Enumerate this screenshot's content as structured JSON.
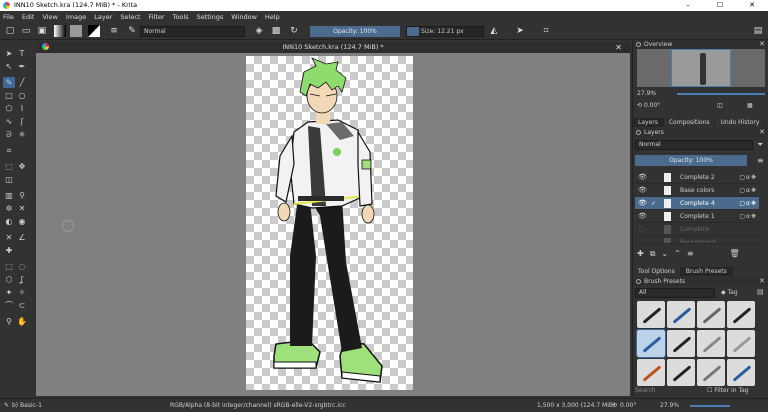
{
  "window": {
    "title": "INN10 Sketch.kra (124.7 MiB) * - Krita",
    "controls": [
      "–",
      "☐",
      "✕"
    ]
  },
  "menu": [
    "File",
    "Edit",
    "View",
    "Image",
    "Layer",
    "Select",
    "Filter",
    "Tools",
    "Settings",
    "Window",
    "Help"
  ],
  "toolbar": {
    "blend_mode": "Normal",
    "opacity": "Opacity: 100%",
    "size": "Size: 12.21 px"
  },
  "document": {
    "tab_title": "INN10 Sketch.kra (124.7 MiB) *",
    "close": "✕"
  },
  "overview": {
    "title": "Overview",
    "zoom": "27.9%",
    "rotation": "0.00°"
  },
  "dock_tabs": [
    "Layers",
    "Compositions",
    "Undo History"
  ],
  "layers": {
    "title": "Layers",
    "blend_mode": "Normal",
    "opacity": "Opacity: 100%",
    "items": [
      {
        "name": "Complete 2",
        "state": "normal"
      },
      {
        "name": "Base colors",
        "state": "normal"
      },
      {
        "name": "Complete 4",
        "state": "selected"
      },
      {
        "name": "Complete 1",
        "state": "normal"
      },
      {
        "name": "Complete",
        "state": "dim"
      },
      {
        "name": "Background",
        "state": "dim"
      }
    ]
  },
  "bottom_tabs": [
    "Tool Options",
    "Brush Presets"
  ],
  "brush_presets": {
    "title": "Brush Presets",
    "filter": "All",
    "tag_label": "Tag",
    "search_placeholder": "Search",
    "filter_in_tag": "Filter in Tag"
  },
  "status": {
    "brush": "b) Basic-1",
    "color_space": "RGB/Alpha (8-bit integer/channel)  sRGB-elle-V2-srgbtrc.icc",
    "dimensions": "1,500 x 3,000 (124.7 MiB)",
    "rotation": "0.00°",
    "zoom": "27.9%"
  }
}
